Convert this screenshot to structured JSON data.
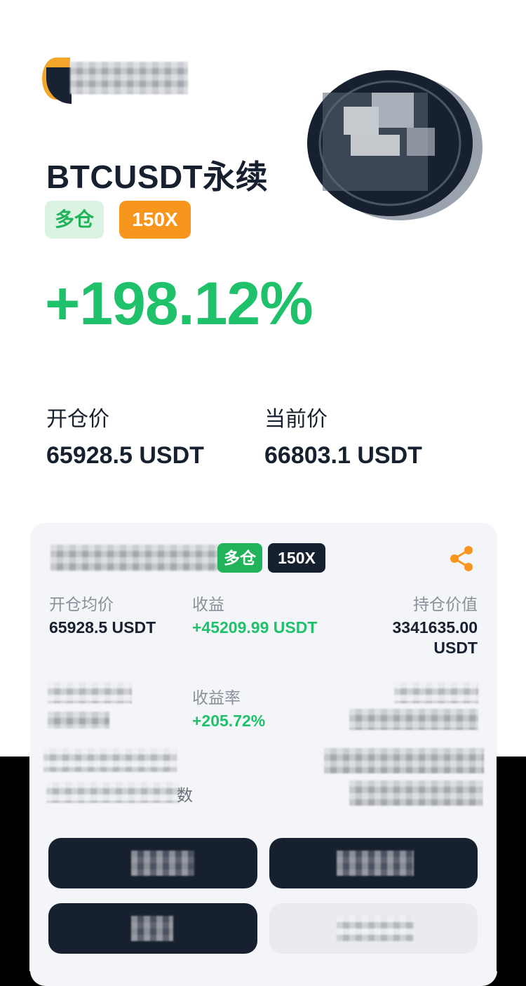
{
  "header": {
    "title": "BTCUSDT永续",
    "position_side": "多仓",
    "leverage": "150X",
    "pnl_percent": "+198.12%"
  },
  "prices": {
    "entry_label": "开仓价",
    "entry_value": "65928.5  USDT",
    "current_label": "当前价",
    "current_value": "66803.1  USDT"
  },
  "card": {
    "position_side": "多仓",
    "leverage": "150X",
    "share_icon": "share-icon",
    "avg_entry_label": "开仓均价",
    "avg_entry_value": "65928.5  USDT",
    "pnl_label": "收益",
    "pnl_value": "+45209.99  USDT",
    "position_value_label": "持仓价值",
    "position_value_line1": "3341635.00",
    "position_value_line2": "USDT",
    "pnl_rate_label": "收益率",
    "pnl_rate_value": "+205.72%",
    "partial_label_fragment": "数"
  },
  "colors": {
    "green": "#1fc16b",
    "orange": "#f7951d",
    "navy": "#17202e",
    "share_orange": "#f7951d"
  }
}
